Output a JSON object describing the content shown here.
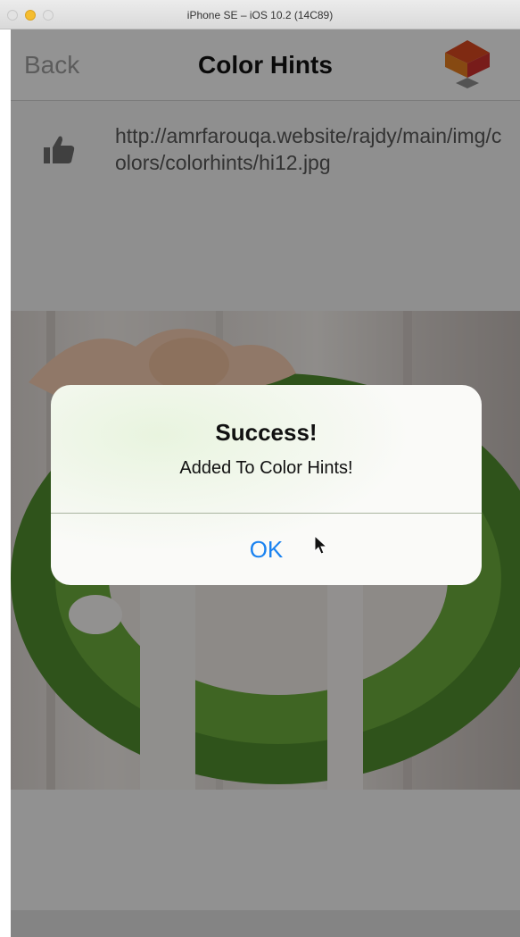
{
  "window": {
    "title": "iPhone SE – iOS 10.2 (14C89)"
  },
  "navbar": {
    "back_label": "Back",
    "title": "Color Hints",
    "logo_icon": "cube-logo-icon"
  },
  "content": {
    "like_icon": "thumbs-up-icon",
    "url": "http://amrfarouqa.website/rajdy/main/img/colors/colorhints/hi12.jpg"
  },
  "alert": {
    "title": "Success!",
    "message": "Added To Color Hints!",
    "ok_label": "OK"
  },
  "colors": {
    "accent": "#1a82f0",
    "logo_orange": "#e07b1f",
    "logo_red": "#c9302c"
  }
}
